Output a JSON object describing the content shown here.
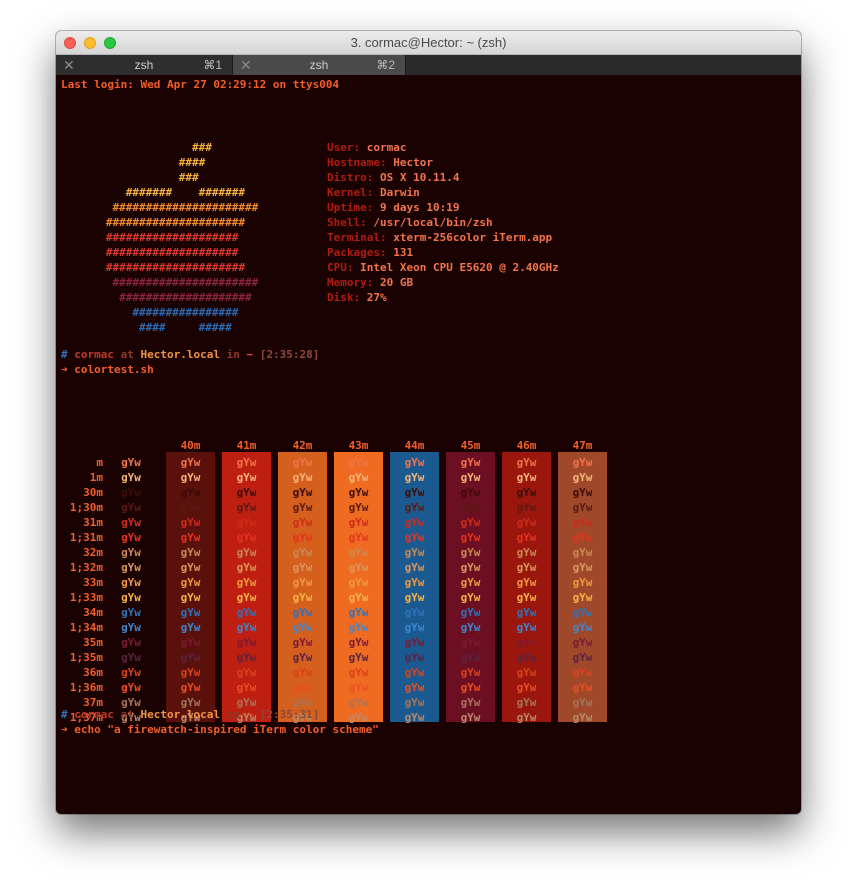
{
  "window": {
    "title": "3. cormac@Hector: ~ (zsh)"
  },
  "tabs": [
    {
      "label": "zsh",
      "shortcut": "⌘1"
    },
    {
      "label": "zsh",
      "shortcut": "⌘2"
    }
  ],
  "terminal": {
    "last_login": "Last login: Wed Apr 27 02:29:12 on ttys004",
    "art": [
      {
        "text": "                ###",
        "color": "#f4b23a"
      },
      {
        "text": "              ####",
        "color": "#f4b23a"
      },
      {
        "text": "              ###",
        "color": "#f4b23a"
      },
      {
        "text": "      #######    #######",
        "color": "#f4b23a"
      },
      {
        "text": "    ######################",
        "color": "#f08a2c"
      },
      {
        "text": "   #####################",
        "color": "#f08a2c"
      },
      {
        "text": "   ####################",
        "color": "#d93a2a"
      },
      {
        "text": "   ####################",
        "color": "#d93a2a"
      },
      {
        "text": "   #####################",
        "color": "#d93a2a"
      },
      {
        "text": "    ######################",
        "color": "#8c2440"
      },
      {
        "text": "     ####################",
        "color": "#8c2440"
      },
      {
        "text": "       ################",
        "color": "#2a6bb5"
      },
      {
        "text": "        ####     #####",
        "color": "#2a6bb5"
      }
    ],
    "sysinfo": [
      {
        "key": "User: ",
        "value": "cormac"
      },
      {
        "key": "Hostname: ",
        "value": "Hector"
      },
      {
        "key": "Distro: ",
        "value": "OS X 10.11.4"
      },
      {
        "key": "Kernel: ",
        "value": "Darwin"
      },
      {
        "key": "Uptime: ",
        "value": "9 days 10:19"
      },
      {
        "key": "Shell: ",
        "value": "/usr/local/bin/zsh"
      },
      {
        "key": "Terminal: ",
        "value": "xterm-256color iTerm.app"
      },
      {
        "key": "Packages: ",
        "value": "131"
      },
      {
        "key": "CPU: ",
        "value": "Intel Xeon CPU E5620 @ 2.40GHz"
      },
      {
        "key": "Memory: ",
        "value": "20 GB"
      },
      {
        "key": "Disk: ",
        "value": "27%"
      }
    ],
    "prompt1": {
      "hash": "#",
      "user": "cormac",
      "at": "at",
      "host": "Hector.local",
      "in": "in",
      "dir": "~",
      "time": "[2:35:28]",
      "arrow": "➜",
      "command": "colortest.sh"
    },
    "prompt2": {
      "hash": "#",
      "user": "cormac",
      "at": "at",
      "host": "Hector.local",
      "in": "in",
      "dir": "~",
      "time": "[2:35:31]",
      "arrow": "➜",
      "command": "echo \"a firewatch-inspired iTerm color scheme\""
    },
    "colortest": {
      "sample": "gYw",
      "bg_labels": [
        "40m",
        "41m",
        "42m",
        "43m",
        "44m",
        "45m",
        "46m",
        "47m"
      ],
      "bg_colors": [
        "#5a100b",
        "#bf1f11",
        "#d55f1c",
        "#ef6b22",
        "#1b5a91",
        "#6d0f22",
        "#9b160d",
        "#a0492a"
      ],
      "rows": [
        {
          "label": "m",
          "color": "#f1744b"
        },
        {
          "label": "1m",
          "color": "#f6b57a"
        },
        {
          "label": "30m",
          "color": "#3d0c0a"
        },
        {
          "label": "1;30m",
          "color": "#5a1a12"
        },
        {
          "label": "31m",
          "color": "#cf2b18"
        },
        {
          "label": "1;31m",
          "color": "#e5331f"
        },
        {
          "label": "32m",
          "color": "#c88a55"
        },
        {
          "label": "1;32m",
          "color": "#d9985e"
        },
        {
          "label": "33m",
          "color": "#f09a40"
        },
        {
          "label": "1;33m",
          "color": "#f7b24a"
        },
        {
          "label": "34m",
          "color": "#2f72b8"
        },
        {
          "label": "1;34m",
          "color": "#3e86cf"
        },
        {
          "label": "35m",
          "color": "#7c1a33"
        },
        {
          "label": "1;35m",
          "color": "#5a2440"
        },
        {
          "label": "36m",
          "color": "#d8421c"
        },
        {
          "label": "1;36m",
          "color": "#ea4f22"
        },
        {
          "label": "37m",
          "color": "#a6755a"
        },
        {
          "label": "1;37m",
          "color": "#b98a6c"
        }
      ]
    }
  },
  "colors": {
    "bg": "#1b0202",
    "accent": "#f15e2c",
    "key": "#b01b0e",
    "value": "#f1744b",
    "host": "#f29447",
    "prompt_hash": "#3a6eb6"
  }
}
